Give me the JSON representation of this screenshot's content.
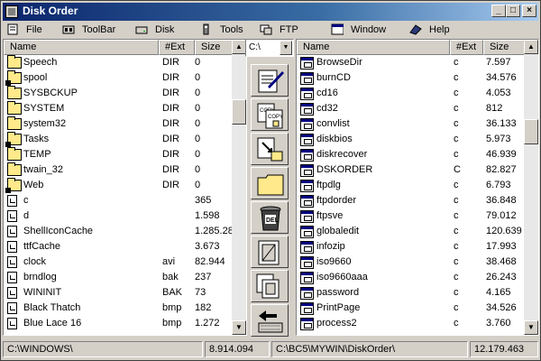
{
  "window": {
    "title": "Disk Order"
  },
  "menu": [
    {
      "label": "File",
      "icon": "file-icon"
    },
    {
      "label": "ToolBar",
      "icon": "toolbar-icon"
    },
    {
      "label": "Disk",
      "icon": "disk-icon"
    },
    {
      "label": "Tools",
      "icon": "tools-icon"
    },
    {
      "label": "FTP",
      "icon": "ftp-icon"
    },
    {
      "label": "Window",
      "icon": "window-icon"
    },
    {
      "label": "Help",
      "icon": "help-icon"
    }
  ],
  "left": {
    "columns": [
      "Name",
      "#Ext",
      "Size"
    ],
    "rows": [
      {
        "name": "Speech",
        "ext": "DIR",
        "size": "0",
        "type": "folder"
      },
      {
        "name": "spool",
        "ext": "DIR",
        "size": "0",
        "type": "folder-short"
      },
      {
        "name": "SYSBCKUP",
        "ext": "DIR",
        "size": "0",
        "type": "folder"
      },
      {
        "name": "SYSTEM",
        "ext": "DIR",
        "size": "0",
        "type": "folder"
      },
      {
        "name": "system32",
        "ext": "DIR",
        "size": "0",
        "type": "folder"
      },
      {
        "name": "Tasks",
        "ext": "DIR",
        "size": "0",
        "type": "folder-short"
      },
      {
        "name": "TEMP",
        "ext": "DIR",
        "size": "0",
        "type": "folder"
      },
      {
        "name": "twain_32",
        "ext": "DIR",
        "size": "0",
        "type": "folder"
      },
      {
        "name": "Web",
        "ext": "DIR",
        "size": "0",
        "type": "folder-short"
      },
      {
        "name": "c",
        "ext": "",
        "size": "365",
        "type": "file"
      },
      {
        "name": "d",
        "ext": "",
        "size": "1.598",
        "type": "file"
      },
      {
        "name": "ShellIconCache",
        "ext": "",
        "size": "1.285.28",
        "type": "file"
      },
      {
        "name": "ttfCache",
        "ext": "",
        "size": "3.673",
        "type": "file"
      },
      {
        "name": "clock",
        "ext": "avi",
        "size": "82.944",
        "type": "file"
      },
      {
        "name": "brndlog",
        "ext": "bak",
        "size": "237",
        "type": "file"
      },
      {
        "name": "WININIT",
        "ext": "BAK",
        "size": "73",
        "type": "file"
      },
      {
        "name": "Black Thatch",
        "ext": "bmp",
        "size": "182",
        "type": "file"
      },
      {
        "name": "Blue Lace 16",
        "ext": "bmp",
        "size": "1.272",
        "type": "file"
      }
    ]
  },
  "right": {
    "columns": [
      "Name",
      "#Ext",
      "Size"
    ],
    "rows": [
      {
        "name": "BrowseDir",
        "ext": "c",
        "size": "7.597"
      },
      {
        "name": "burnCD",
        "ext": "c",
        "size": "34.576"
      },
      {
        "name": "cd16",
        "ext": "c",
        "size": "4.053"
      },
      {
        "name": "cd32",
        "ext": "c",
        "size": "812"
      },
      {
        "name": "convlist",
        "ext": "c",
        "size": "36.133"
      },
      {
        "name": "diskbios",
        "ext": "c",
        "size": "5.973"
      },
      {
        "name": "diskrecover",
        "ext": "c",
        "size": "46.939"
      },
      {
        "name": "DSKORDER",
        "ext": "C",
        "size": "82.827"
      },
      {
        "name": "ftpdlg",
        "ext": "c",
        "size": "6.793"
      },
      {
        "name": "ftpdorder",
        "ext": "c",
        "size": "36.848"
      },
      {
        "name": "ftpsve",
        "ext": "c",
        "size": "79.012"
      },
      {
        "name": "globaledit",
        "ext": "c",
        "size": "120.639"
      },
      {
        "name": "infozip",
        "ext": "c",
        "size": "17.993"
      },
      {
        "name": "iso9660",
        "ext": "c",
        "size": "38.468"
      },
      {
        "name": "iso9660aaa",
        "ext": "c",
        "size": "26.243"
      },
      {
        "name": "password",
        "ext": "c",
        "size": "4.165"
      },
      {
        "name": "PrintPage",
        "ext": "c",
        "size": "34.526"
      },
      {
        "name": "process2",
        "ext": "c",
        "size": "3.760"
      }
    ]
  },
  "drive": {
    "label": "C:\\"
  },
  "tools": [
    "edit-icon",
    "copy-icon",
    "move-icon",
    "new-folder-icon",
    "delete-icon",
    "sort-left-icon",
    "sort-right-icon",
    "swap-icon"
  ],
  "status": {
    "left_path": "C:\\WINDOWS\\",
    "left_size": "8.914.094",
    "right_path": "C:\\BC5\\MYWIN\\DiskOrder\\",
    "right_size": "12.179.463"
  }
}
